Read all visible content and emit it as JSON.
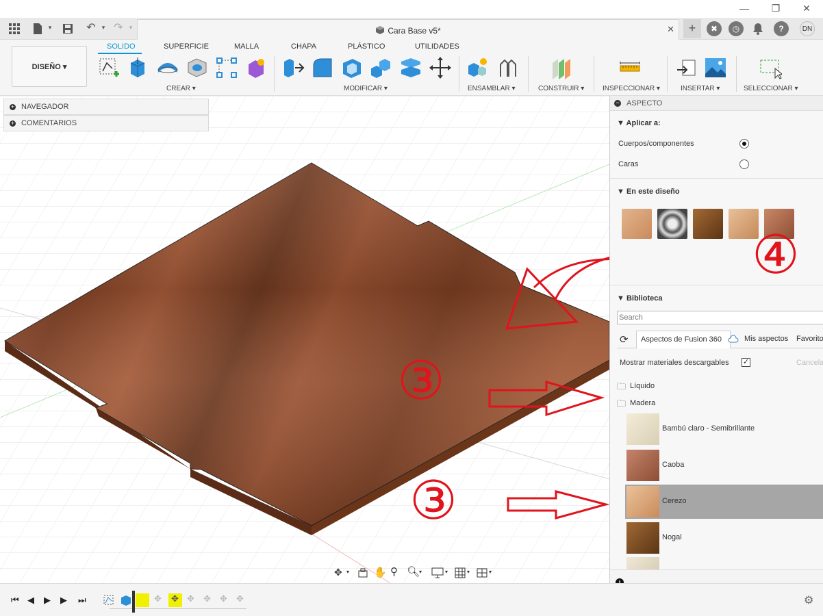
{
  "window": {
    "minimize": "—",
    "maximize": "❐",
    "close": "✕"
  },
  "document": {
    "title": "Cara Base v5*",
    "close": "✕",
    "new_tab": "+"
  },
  "user": {
    "initials": "DN"
  },
  "ribbon": {
    "workspace": "DISEÑO ▾",
    "tabs": [
      "SOLIDO",
      "SUPERFICIE",
      "MALLA",
      "CHAPA",
      "PLÁSTICO",
      "UTILIDADES"
    ],
    "groups": [
      "CREAR ▾",
      "MODIFICAR ▾",
      "ENSAMBLAR ▾",
      "CONSTRUIR ▾",
      "INSPECCIONAR ▾",
      "INSERTAR ▾",
      "SELECCIONAR ▾"
    ]
  },
  "left_panels": {
    "browser": "NAVEGADOR",
    "comments": "COMENTARIOS"
  },
  "aspect_panel": {
    "title": "ASPECTO",
    "apply_to": "Aplicar a:",
    "option_bodies": "Cuerpos/componentes",
    "option_faces": "Caras",
    "in_design": "En este diseño",
    "library": "Biblioteca",
    "search_placeholder": "Search",
    "tab_fusion": "Aspectos de Fusion 360",
    "tab_mine": "Mis aspectos",
    "tab_fav": "Favoritos",
    "show_downloadable": "Mostrar materiales descargables",
    "cancel": "Cancelar",
    "folders": [
      "Líquido",
      "Madera"
    ],
    "items": [
      "Bambú claro - Semibrillante",
      "Caoba",
      "Cerezo",
      "Nogal"
    ]
  },
  "annotations": {
    "step3a": "③",
    "step3b": "③",
    "step4": "④"
  },
  "colors": {
    "accent": "#0696d7",
    "annotation": "#e0141c",
    "selected_row": "#a6a6a6",
    "wood": "#8b4a2c"
  }
}
